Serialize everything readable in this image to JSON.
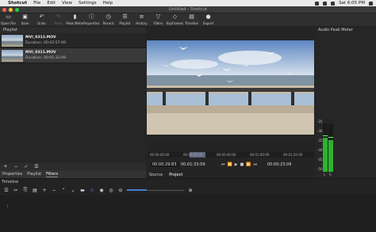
{
  "menubar": {
    "apple": "",
    "app": "Shotcut",
    "items": [
      "File",
      "Edit",
      "View",
      "Settings",
      "Help"
    ],
    "clock": "Sat 6:05 PM"
  },
  "window": {
    "title": "Untitled - Shotcut"
  },
  "toolbar": {
    "buttons": [
      {
        "label": "Open File",
        "icon": "folder-open-icon",
        "enabled": true
      },
      {
        "label": "Save",
        "icon": "save-icon",
        "enabled": true
      },
      {
        "label": "Undo",
        "icon": "undo-icon",
        "enabled": true
      },
      {
        "label": "Redo",
        "icon": "redo-icon",
        "enabled": false
      },
      {
        "label": "Peak Meter",
        "icon": "peak-meter-icon",
        "enabled": true
      },
      {
        "label": "Properties",
        "icon": "properties-icon",
        "enabled": true
      },
      {
        "label": "Recent",
        "icon": "recent-icon",
        "enabled": true
      },
      {
        "label": "Playlist",
        "icon": "playlist-icon",
        "enabled": true
      },
      {
        "label": "History",
        "icon": "history-icon",
        "enabled": true
      },
      {
        "label": "Filters",
        "icon": "filter-icon",
        "enabled": true
      },
      {
        "label": "Keyframes",
        "icon": "keyframes-icon",
        "enabled": true
      },
      {
        "label": "Timeline",
        "icon": "timeline-icon",
        "enabled": true
      },
      {
        "label": "Export",
        "icon": "export-icon",
        "enabled": true
      }
    ]
  },
  "playlist": {
    "title": "Playlist",
    "items": [
      {
        "name": "MVI_0313.MOV",
        "duration": "Duration: 00:03:57:09"
      },
      {
        "name": "MVI_0311.MOV",
        "duration": "Duration: 00:01:33:09"
      }
    ],
    "tabs": [
      "Properties",
      "Playlist",
      "Filters"
    ],
    "active_tab": "Filters"
  },
  "viewer": {
    "ruler_ticks": [
      "00:00:00:00",
      "00:00:20:00",
      "00:00:40:00",
      "00:01:00:00",
      "00:01:20:00"
    ],
    "position_fraction": 0.26,
    "timecode_current": "00:00:29:83",
    "timecode_duration": "00:01:33:09",
    "timecode_io": "00:00:23:06",
    "source_tab": "Source",
    "project_tab": "Project"
  },
  "peak_meter": {
    "title": "Audio Peak Meter",
    "scale": [
      "-25",
      "-30",
      "-35",
      "-40",
      "-45",
      "-50"
    ],
    "left_level_fraction": 0.7,
    "right_level_fraction": 0.66,
    "left_label": "L",
    "right_label": "R",
    "color": "#2db32d"
  },
  "timeline": {
    "title": "Timeline",
    "zoom_fraction": 0.35,
    "accent": "#4a7bd6"
  },
  "colors": {
    "accent": "#4a7bd6",
    "meter": "#2db32d"
  }
}
